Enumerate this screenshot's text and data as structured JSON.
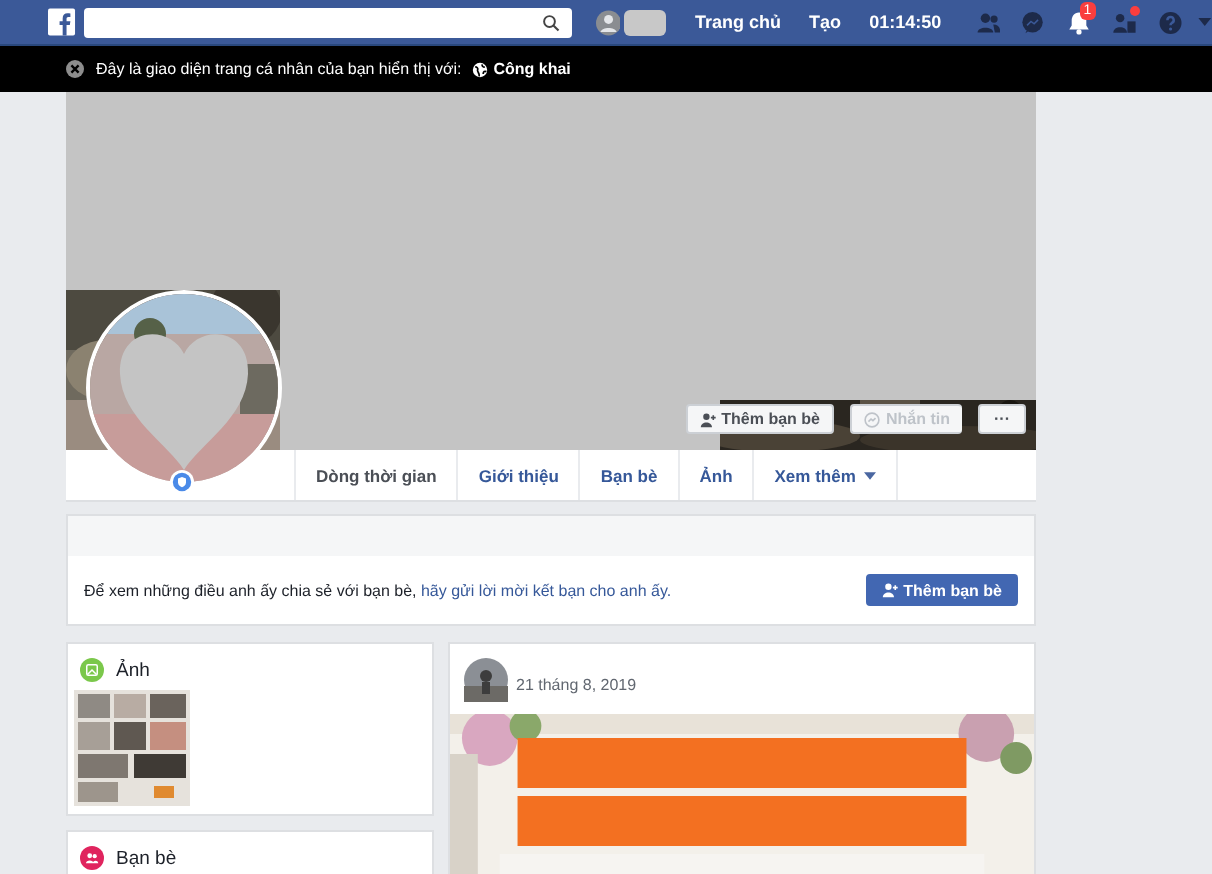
{
  "top_bar": {
    "links": [
      "Trang chủ",
      "Tạo",
      "01:14:50"
    ],
    "notification_badge": "1"
  },
  "privacy_notice": {
    "text": "Đây là giao diện trang cá nhân của bạn hiển thị với:",
    "audience": "Công khai"
  },
  "profile_actions": [
    {
      "kind": "add",
      "label": "Thêm bạn bè",
      "disabled": false
    },
    {
      "kind": "message",
      "label": "Nhắn tin",
      "disabled": true
    },
    {
      "kind": "more",
      "label": "···",
      "disabled": false
    }
  ],
  "tabs": [
    {
      "label": "Dòng thời gian",
      "selected": true
    },
    {
      "label": "Giới thiệu",
      "selected": false
    },
    {
      "label": "Bạn bè",
      "selected": false
    },
    {
      "label": "Ảnh",
      "selected": false
    },
    {
      "label": "Xem thêm",
      "selected": false
    }
  ],
  "friend_prompt": {
    "text": "Để xem những điều anh ấy chia sẻ với bạn bè,",
    "link": "hãy gửi lời mời kết bạn cho anh ấy.",
    "button": "Thêm bạn bè"
  },
  "side_cards": [
    {
      "kind": "photos",
      "title": "Ảnh"
    },
    {
      "kind": "friends",
      "title": "Bạn bè"
    }
  ],
  "post": {
    "date": "21 tháng 8, 2019"
  }
}
